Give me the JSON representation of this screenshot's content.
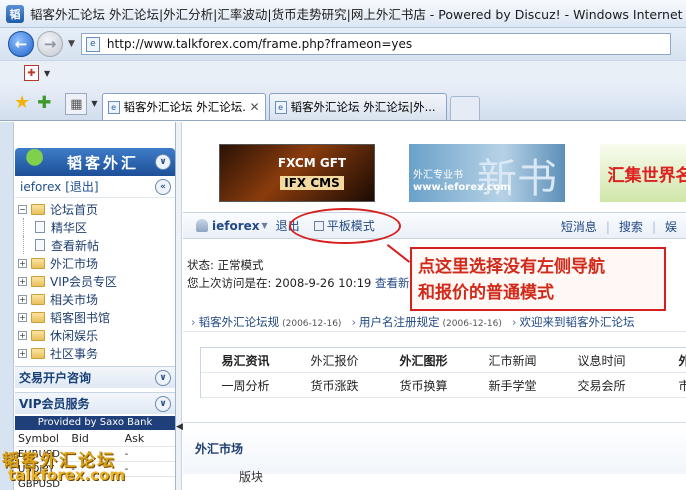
{
  "window": {
    "title": "韬客外汇论坛 外汇论坛|外汇分析|汇率波动|货币走势研究|网上外汇书店 - Powered by Discuz! - Windows Internet Explorer"
  },
  "address": {
    "url": "http://www.talkforex.com/frame.php?frameon=yes"
  },
  "tabs": [
    {
      "label": "韬客外汇论坛 外汇论坛...",
      "active": true
    },
    {
      "label": "韬客外汇论坛 外汇论坛|外...",
      "active": false
    }
  ],
  "sidebar": {
    "logo_text": "韬客外汇",
    "user": {
      "name": "ieforex",
      "logout": "[退出]"
    },
    "tree": [
      {
        "label": "论坛首页",
        "type": "home"
      },
      {
        "label": "精华区",
        "type": "doc"
      },
      {
        "label": "查看新帖",
        "type": "doc"
      },
      {
        "label": "外汇市场",
        "type": "folder"
      },
      {
        "label": "VIP会员专区",
        "type": "folder"
      },
      {
        "label": "相关市场",
        "type": "folder"
      },
      {
        "label": "韬客图书馆",
        "type": "folder"
      },
      {
        "label": "休闲娱乐",
        "type": "folder"
      },
      {
        "label": "社区事务",
        "type": "folder"
      }
    ],
    "sections": [
      "交易开户咨询",
      "VIP会员服务"
    ],
    "provided_by": "Provided by Saxo Bank",
    "quotes": {
      "headers": [
        "Symbol",
        "Bid",
        "Ask"
      ],
      "rows": [
        {
          "symbol": "EURUSD",
          "bid": "-",
          "ask": "-"
        },
        {
          "symbol": "USDJPY",
          "bid": "-",
          "ask": "-"
        },
        {
          "symbol": "GBPUSD",
          "bid": "",
          "ask": ""
        }
      ]
    },
    "watermark": {
      "cn": "韬客外汇论坛",
      "url": "talkforex.com"
    }
  },
  "banners": {
    "fxcm": {
      "line1": "FXCM  GFT",
      "line2": "IFX CMS"
    },
    "ieforex": {
      "line1": "外汇专业书",
      "line2": "www.ieforex.com",
      "big": "新书"
    },
    "huiji": "汇集世界名"
  },
  "navbar": {
    "user": "ieforex",
    "logout": "退出",
    "flat_mode": "平板模式",
    "right": [
      "短消息",
      "搜索",
      "娱"
    ]
  },
  "status": {
    "line1": "状态: 正常模式",
    "line2_prefix": "您上次访问是在: 2008-9-26 10:19",
    "line2_link": "查看新"
  },
  "callout": {
    "line1": "点这里选择没有左侧导航",
    "line2": "和报价的普通模式"
  },
  "notices": [
    {
      "title": "韬客外汇论坛规",
      "date": "(2006-12-16)"
    },
    {
      "title": "用户名注册规定",
      "date": "(2006-12-16)"
    },
    {
      "title": "欢迎来到韬客外汇论坛",
      "date": ""
    }
  ],
  "quicklinks": [
    [
      "易汇资讯",
      "外汇报价",
      "外汇图形",
      "汇市新闻",
      "议息时间",
      "外汇"
    ],
    [
      "一周分析",
      "货币涨跌",
      "货币换算",
      "新手学堂",
      "交易会所",
      "市场"
    ]
  ],
  "quicklinks_bold": [
    true,
    false,
    true,
    false,
    false,
    true
  ],
  "forum": {
    "category": "外汇市场",
    "sub": "版块"
  },
  "colors": {
    "accent": "#234a86",
    "callout": "#d62020",
    "sidebar_header": "#1d4f98"
  }
}
